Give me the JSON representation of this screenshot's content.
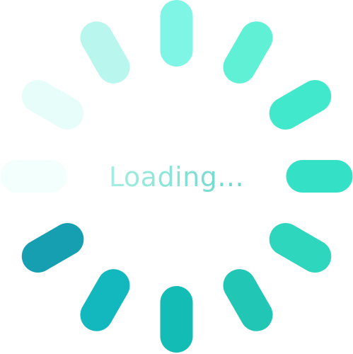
{
  "loader": {
    "text": "Loading...",
    "segment_count": 12,
    "segment_colors": [
      "#7ff5e6",
      "#5ff0d6",
      "#42e8cc",
      "#34e0c6",
      "#2ed6bd",
      "#22c6b4",
      "#14bcb6",
      "#13b8bf",
      "#159fb1",
      "#f3fffd",
      "#e7fdf9",
      "#b9f6ee"
    ]
  }
}
